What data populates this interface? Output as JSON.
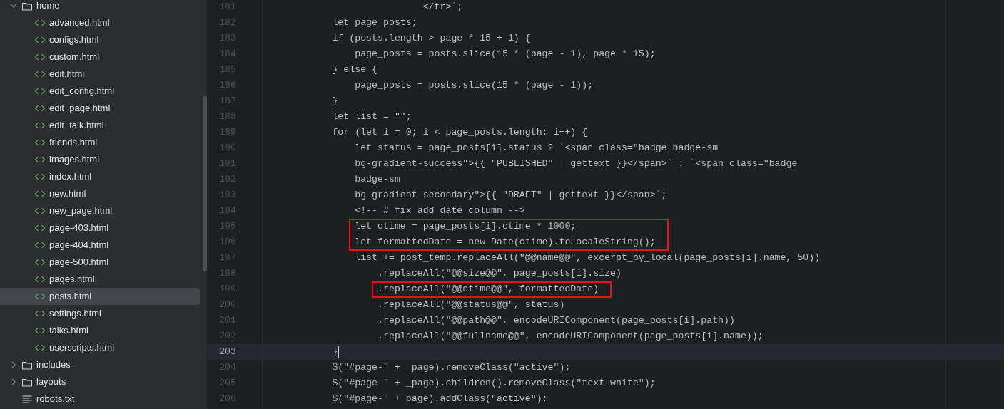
{
  "project_tree": [
    {
      "kind": "folder",
      "label": "home",
      "expanded": true,
      "selected": false,
      "children": [
        {
          "kind": "html",
          "label": "advanced.html",
          "selected": false
        },
        {
          "kind": "html",
          "label": "configs.html",
          "selected": false
        },
        {
          "kind": "html",
          "label": "custom.html",
          "selected": false
        },
        {
          "kind": "html",
          "label": "edit.html",
          "selected": false
        },
        {
          "kind": "html",
          "label": "edit_config.html",
          "selected": false
        },
        {
          "kind": "html",
          "label": "edit_page.html",
          "selected": false
        },
        {
          "kind": "html",
          "label": "edit_talk.html",
          "selected": false
        },
        {
          "kind": "html",
          "label": "friends.html",
          "selected": false
        },
        {
          "kind": "html",
          "label": "images.html",
          "selected": false
        },
        {
          "kind": "html",
          "label": "index.html",
          "selected": false
        },
        {
          "kind": "html",
          "label": "new.html",
          "selected": false
        },
        {
          "kind": "html",
          "label": "new_page.html",
          "selected": false
        },
        {
          "kind": "html",
          "label": "page-403.html",
          "selected": false
        },
        {
          "kind": "html",
          "label": "page-404.html",
          "selected": false
        },
        {
          "kind": "html",
          "label": "page-500.html",
          "selected": false
        },
        {
          "kind": "html",
          "label": "pages.html",
          "selected": false
        },
        {
          "kind": "html",
          "label": "posts.html",
          "selected": true
        },
        {
          "kind": "html",
          "label": "settings.html",
          "selected": false
        },
        {
          "kind": "html",
          "label": "talks.html",
          "selected": false
        },
        {
          "kind": "html",
          "label": "userscripts.html",
          "selected": false
        }
      ]
    },
    {
      "kind": "folder",
      "label": "includes",
      "expanded": false,
      "selected": false
    },
    {
      "kind": "folder",
      "label": "layouts",
      "expanded": false,
      "selected": false
    },
    {
      "kind": "text",
      "label": "robots.txt",
      "selected": false
    }
  ],
  "editor": {
    "lines": [
      {
        "number": "181",
        "code": "                            </tr>`;",
        "current": false,
        "boxed": false
      },
      {
        "number": "182",
        "code": "            let page_posts;",
        "current": false,
        "boxed": false
      },
      {
        "number": "183",
        "code": "            if (posts.length > page * 15 + 1) {",
        "current": false,
        "boxed": false
      },
      {
        "number": "184",
        "code": "                page_posts = posts.slice(15 * (page - 1), page * 15);",
        "current": false,
        "boxed": false
      },
      {
        "number": "185",
        "code": "            } else {",
        "current": false,
        "boxed": false
      },
      {
        "number": "186",
        "code": "                page_posts = posts.slice(15 * (page - 1));",
        "current": false,
        "boxed": false
      },
      {
        "number": "187",
        "code": "            }",
        "current": false,
        "boxed": false
      },
      {
        "number": "188",
        "code": "            let list = \"\";",
        "current": false,
        "boxed": false
      },
      {
        "number": "189",
        "code": "            for (let i = 0; i < page_posts.length; i++) {",
        "current": false,
        "boxed": false
      },
      {
        "number": "190",
        "code": "                let status = page_posts[i].status ? `<span class=\"badge badge-sm",
        "current": false,
        "boxed": false
      },
      {
        "number": "191",
        "code": "                bg-gradient-success\">{{ \"PUBLISHED\" | gettext }}</span>` : `<span class=\"badge",
        "current": false,
        "boxed": false
      },
      {
        "number": "192",
        "code": "                badge-sm",
        "current": false,
        "boxed": false
      },
      {
        "number": "193",
        "code": "                bg-gradient-secondary\">{{ \"DRAFT\" | gettext }}</span>`;",
        "current": false,
        "boxed": false
      },
      {
        "number": "194",
        "code": "                <!-- # fix add date column -->",
        "current": false,
        "boxed": false
      },
      {
        "number": "195",
        "code": "                let ctime = page_posts[i].ctime * 1000;",
        "current": false,
        "boxed": true
      },
      {
        "number": "196",
        "code": "                let formattedDate = new Date(ctime).toLocaleString();",
        "current": false,
        "boxed": true
      },
      {
        "number": "197",
        "code": "                list += post_temp.replaceAll(\"@@name@@\", excerpt_by_local(page_posts[i].name, 50))",
        "current": false,
        "boxed": false
      },
      {
        "number": "198",
        "code": "                    .replaceAll(\"@@size@@\", page_posts[i].size)",
        "current": false,
        "boxed": false
      },
      {
        "number": "199",
        "code": "                    .replaceAll(\"@@ctime@@\", formattedDate)",
        "current": false,
        "boxed": true
      },
      {
        "number": "200",
        "code": "                    .replaceAll(\"@@status@@\", status)",
        "current": false,
        "boxed": false
      },
      {
        "number": "201",
        "code": "                    .replaceAll(\"@@path@@\", encodeURIComponent(page_posts[i].path))",
        "current": false,
        "boxed": false
      },
      {
        "number": "202",
        "code": "                    .replaceAll(\"@@fullname@@\", encodeURIComponent(page_posts[i].name));",
        "current": false,
        "boxed": false
      },
      {
        "number": "203",
        "code": "            }",
        "current": true,
        "boxed": false
      },
      {
        "number": "204",
        "code": "            $(\"#page-\" + _page).removeClass(\"active\");",
        "current": false,
        "boxed": false
      },
      {
        "number": "205",
        "code": "            $(\"#page-\" + _page).children().removeClass(\"text-white\");",
        "current": false,
        "boxed": false
      },
      {
        "number": "206",
        "code": "            $(\"#page-\" + page).addClass(\"active\");",
        "current": false,
        "boxed": false
      }
    ]
  }
}
